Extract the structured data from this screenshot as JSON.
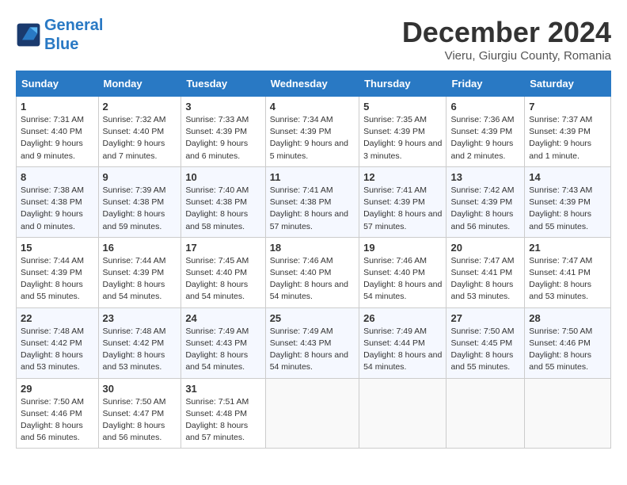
{
  "logo": {
    "line1": "General",
    "line2": "Blue"
  },
  "title": "December 2024",
  "subtitle": "Vieru, Giurgiu County, Romania",
  "weekdays": [
    "Sunday",
    "Monday",
    "Tuesday",
    "Wednesday",
    "Thursday",
    "Friday",
    "Saturday"
  ],
  "weeks": [
    [
      {
        "day": "1",
        "sunrise": "Sunrise: 7:31 AM",
        "sunset": "Sunset: 4:40 PM",
        "daylight": "Daylight: 9 hours and 9 minutes."
      },
      {
        "day": "2",
        "sunrise": "Sunrise: 7:32 AM",
        "sunset": "Sunset: 4:40 PM",
        "daylight": "Daylight: 9 hours and 7 minutes."
      },
      {
        "day": "3",
        "sunrise": "Sunrise: 7:33 AM",
        "sunset": "Sunset: 4:39 PM",
        "daylight": "Daylight: 9 hours and 6 minutes."
      },
      {
        "day": "4",
        "sunrise": "Sunrise: 7:34 AM",
        "sunset": "Sunset: 4:39 PM",
        "daylight": "Daylight: 9 hours and 5 minutes."
      },
      {
        "day": "5",
        "sunrise": "Sunrise: 7:35 AM",
        "sunset": "Sunset: 4:39 PM",
        "daylight": "Daylight: 9 hours and 3 minutes."
      },
      {
        "day": "6",
        "sunrise": "Sunrise: 7:36 AM",
        "sunset": "Sunset: 4:39 PM",
        "daylight": "Daylight: 9 hours and 2 minutes."
      },
      {
        "day": "7",
        "sunrise": "Sunrise: 7:37 AM",
        "sunset": "Sunset: 4:39 PM",
        "daylight": "Daylight: 9 hours and 1 minute."
      }
    ],
    [
      {
        "day": "8",
        "sunrise": "Sunrise: 7:38 AM",
        "sunset": "Sunset: 4:38 PM",
        "daylight": "Daylight: 9 hours and 0 minutes."
      },
      {
        "day": "9",
        "sunrise": "Sunrise: 7:39 AM",
        "sunset": "Sunset: 4:38 PM",
        "daylight": "Daylight: 8 hours and 59 minutes."
      },
      {
        "day": "10",
        "sunrise": "Sunrise: 7:40 AM",
        "sunset": "Sunset: 4:38 PM",
        "daylight": "Daylight: 8 hours and 58 minutes."
      },
      {
        "day": "11",
        "sunrise": "Sunrise: 7:41 AM",
        "sunset": "Sunset: 4:38 PM",
        "daylight": "Daylight: 8 hours and 57 minutes."
      },
      {
        "day": "12",
        "sunrise": "Sunrise: 7:41 AM",
        "sunset": "Sunset: 4:39 PM",
        "daylight": "Daylight: 8 hours and 57 minutes."
      },
      {
        "day": "13",
        "sunrise": "Sunrise: 7:42 AM",
        "sunset": "Sunset: 4:39 PM",
        "daylight": "Daylight: 8 hours and 56 minutes."
      },
      {
        "day": "14",
        "sunrise": "Sunrise: 7:43 AM",
        "sunset": "Sunset: 4:39 PM",
        "daylight": "Daylight: 8 hours and 55 minutes."
      }
    ],
    [
      {
        "day": "15",
        "sunrise": "Sunrise: 7:44 AM",
        "sunset": "Sunset: 4:39 PM",
        "daylight": "Daylight: 8 hours and 55 minutes."
      },
      {
        "day": "16",
        "sunrise": "Sunrise: 7:44 AM",
        "sunset": "Sunset: 4:39 PM",
        "daylight": "Daylight: 8 hours and 54 minutes."
      },
      {
        "day": "17",
        "sunrise": "Sunrise: 7:45 AM",
        "sunset": "Sunset: 4:40 PM",
        "daylight": "Daylight: 8 hours and 54 minutes."
      },
      {
        "day": "18",
        "sunrise": "Sunrise: 7:46 AM",
        "sunset": "Sunset: 4:40 PM",
        "daylight": "Daylight: 8 hours and 54 minutes."
      },
      {
        "day": "19",
        "sunrise": "Sunrise: 7:46 AM",
        "sunset": "Sunset: 4:40 PM",
        "daylight": "Daylight: 8 hours and 54 minutes."
      },
      {
        "day": "20",
        "sunrise": "Sunrise: 7:47 AM",
        "sunset": "Sunset: 4:41 PM",
        "daylight": "Daylight: 8 hours and 53 minutes."
      },
      {
        "day": "21",
        "sunrise": "Sunrise: 7:47 AM",
        "sunset": "Sunset: 4:41 PM",
        "daylight": "Daylight: 8 hours and 53 minutes."
      }
    ],
    [
      {
        "day": "22",
        "sunrise": "Sunrise: 7:48 AM",
        "sunset": "Sunset: 4:42 PM",
        "daylight": "Daylight: 8 hours and 53 minutes."
      },
      {
        "day": "23",
        "sunrise": "Sunrise: 7:48 AM",
        "sunset": "Sunset: 4:42 PM",
        "daylight": "Daylight: 8 hours and 53 minutes."
      },
      {
        "day": "24",
        "sunrise": "Sunrise: 7:49 AM",
        "sunset": "Sunset: 4:43 PM",
        "daylight": "Daylight: 8 hours and 54 minutes."
      },
      {
        "day": "25",
        "sunrise": "Sunrise: 7:49 AM",
        "sunset": "Sunset: 4:43 PM",
        "daylight": "Daylight: 8 hours and 54 minutes."
      },
      {
        "day": "26",
        "sunrise": "Sunrise: 7:49 AM",
        "sunset": "Sunset: 4:44 PM",
        "daylight": "Daylight: 8 hours and 54 minutes."
      },
      {
        "day": "27",
        "sunrise": "Sunrise: 7:50 AM",
        "sunset": "Sunset: 4:45 PM",
        "daylight": "Daylight: 8 hours and 55 minutes."
      },
      {
        "day": "28",
        "sunrise": "Sunrise: 7:50 AM",
        "sunset": "Sunset: 4:46 PM",
        "daylight": "Daylight: 8 hours and 55 minutes."
      }
    ],
    [
      {
        "day": "29",
        "sunrise": "Sunrise: 7:50 AM",
        "sunset": "Sunset: 4:46 PM",
        "daylight": "Daylight: 8 hours and 56 minutes."
      },
      {
        "day": "30",
        "sunrise": "Sunrise: 7:50 AM",
        "sunset": "Sunset: 4:47 PM",
        "daylight": "Daylight: 8 hours and 56 minutes."
      },
      {
        "day": "31",
        "sunrise": "Sunrise: 7:51 AM",
        "sunset": "Sunset: 4:48 PM",
        "daylight": "Daylight: 8 hours and 57 minutes."
      },
      null,
      null,
      null,
      null
    ]
  ]
}
